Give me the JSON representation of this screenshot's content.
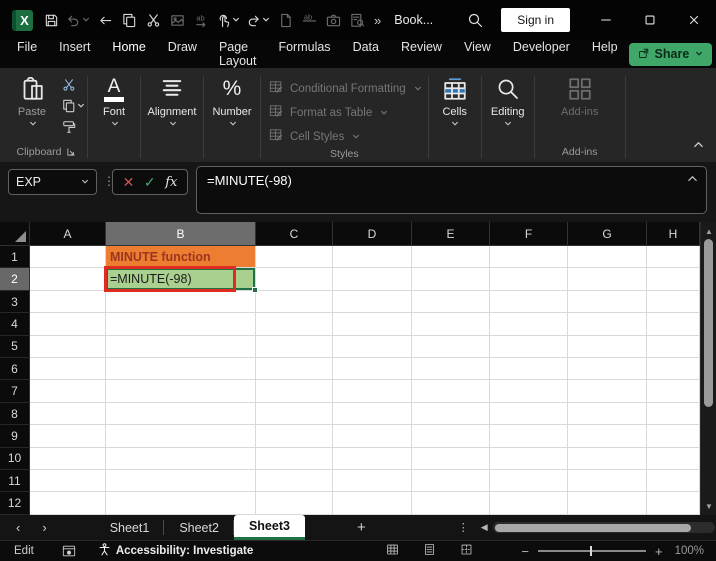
{
  "colors": {
    "excel_green": "#1D6F42",
    "share_button_green": "#3FA768",
    "active_tab_underline": "#35A463",
    "cell_orange": "#ED7D31",
    "cell_orange_text": "#9C3620",
    "cell_green": "#A9D08E",
    "annotation_red": "#E02B20",
    "selection_green": "#1E7145"
  },
  "titlebar": {
    "qat_icons": [
      "save",
      "undo",
      "back",
      "copy",
      "cut",
      "picture",
      "replace",
      "touch-mode",
      "redo",
      "new-file",
      "strikethrough",
      "camera",
      "workbook-stats"
    ],
    "overflow": "»",
    "doc_title": "Book...",
    "sign_in_label": "Sign in",
    "window_icons": [
      "minimize",
      "maximize",
      "close"
    ]
  },
  "menu": {
    "tabs": [
      "File",
      "Insert",
      "Home",
      "Draw",
      "Page Layout",
      "Formulas",
      "Data",
      "Review",
      "View",
      "Developer",
      "Help"
    ],
    "active_tab": "Home",
    "share_label": "Share"
  },
  "ribbon": {
    "paste_label": "Paste",
    "clipboard_group_label": "Clipboard",
    "font_label": "Font",
    "alignment_label": "Alignment",
    "number_label": "Number",
    "styles_items": [
      "Conditional Formatting",
      "Format as Table",
      "Cell Styles"
    ],
    "styles_group_label": "Styles",
    "cells_label": "Cells",
    "editing_label": "Editing",
    "addins_label": "Add-ins",
    "addins_group_label": "Add-ins"
  },
  "formula_bar": {
    "name_box_value": "EXP",
    "fx_label": "fx",
    "formula": "=MINUTE(-98)"
  },
  "grid": {
    "columns": [
      "A",
      "B",
      "C",
      "D",
      "E",
      "F",
      "G",
      "H"
    ],
    "rows": [
      "1",
      "2",
      "3",
      "4",
      "5",
      "6",
      "7",
      "8",
      "9",
      "10",
      "11",
      "12"
    ],
    "selected_column": "B",
    "selected_row": "2",
    "cells": {
      "B1": {
        "text": "MINUTE function",
        "bg": "#ED7D31",
        "color": "#9C3620",
        "bold": true
      },
      "B2": {
        "text": "=MINUTE(-98)",
        "bg": "#A9D08E",
        "color": "#1A1A1A",
        "red_box": true,
        "selected": true
      }
    }
  },
  "sheet_tabs": {
    "nav_icons": [
      "sheet-prev",
      "sheet-next"
    ],
    "tabs": [
      "Sheet1",
      "Sheet2",
      "Sheet3"
    ],
    "active_tab": "Sheet3",
    "add_label": "+"
  },
  "status_bar": {
    "mode": "Edit",
    "accessibility_label": "Accessibility: Investigate",
    "view_icons": [
      "normal-view",
      "page-layout-view",
      "page-break-view"
    ],
    "zoom_level": "100%"
  }
}
